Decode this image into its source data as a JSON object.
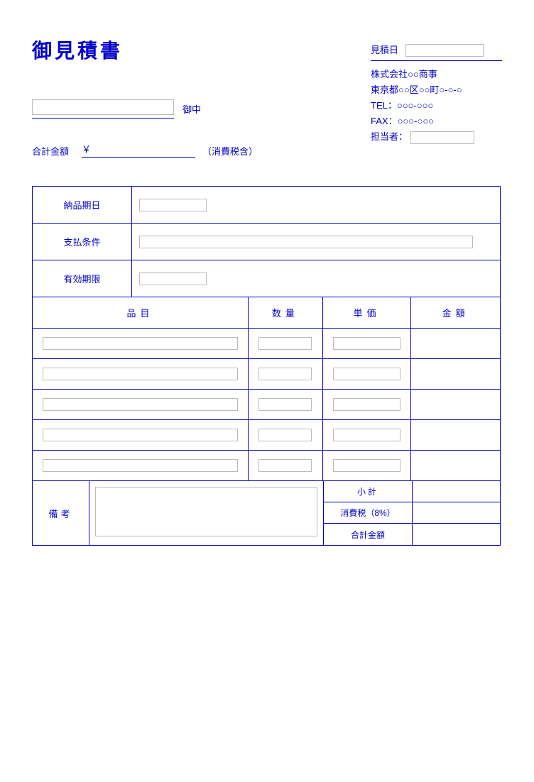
{
  "title": "御見積書",
  "date": {
    "label": "見積日",
    "value": ""
  },
  "company": {
    "name": "株式会社○○商事",
    "address": "東京都○○区○○町○-○-○",
    "tel_label": "TEL：",
    "tel": "○○○-○○○",
    "fax_label": "FAX：",
    "fax": "○○○-○○○",
    "person_label": "担当者：",
    "person": ""
  },
  "client": {
    "honorific": "御中",
    "value": ""
  },
  "total_top": {
    "label": "合計金額",
    "currency": "￥",
    "value": "",
    "tax_note": "（消費税含）"
  },
  "conditions": {
    "delivery": {
      "label": "納品期日",
      "value": ""
    },
    "payment": {
      "label": "支払条件",
      "value": ""
    },
    "validity": {
      "label": "有効期限",
      "value": ""
    }
  },
  "columns": {
    "item": "品目",
    "qty": "数量",
    "unit": "単価",
    "amount": "金額"
  },
  "rows": [
    {
      "item": "",
      "qty": "",
      "unit": "",
      "amount": ""
    },
    {
      "item": "",
      "qty": "",
      "unit": "",
      "amount": ""
    },
    {
      "item": "",
      "qty": "",
      "unit": "",
      "amount": ""
    },
    {
      "item": "",
      "qty": "",
      "unit": "",
      "amount": ""
    },
    {
      "item": "",
      "qty": "",
      "unit": "",
      "amount": ""
    }
  ],
  "notes": {
    "label": "備考",
    "value": ""
  },
  "summary": {
    "subtotal": {
      "label": "小計",
      "value": ""
    },
    "tax": {
      "label": "消費税（8%）",
      "value": ""
    },
    "total": {
      "label": "合計金額",
      "value": ""
    }
  }
}
